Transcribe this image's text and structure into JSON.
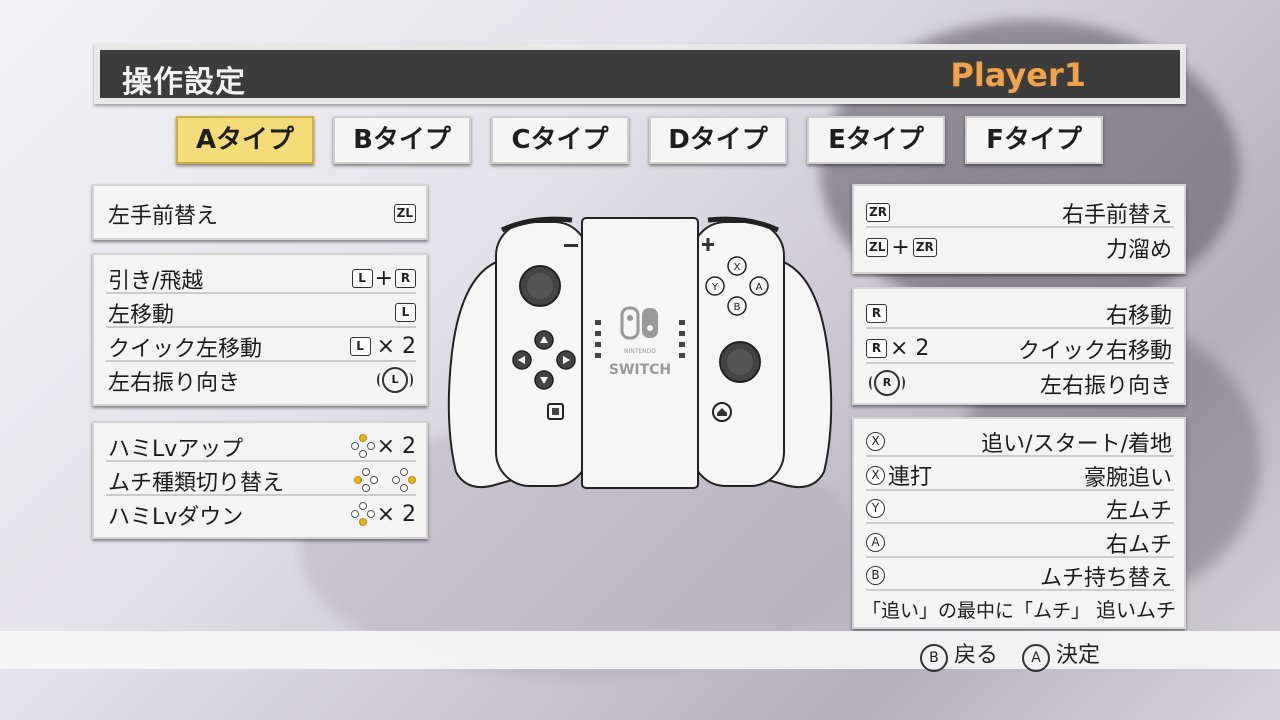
{
  "header": {
    "title": "操作設定",
    "player": "Player1"
  },
  "tabs": [
    "Aタイプ",
    "Bタイプ",
    "Cタイプ",
    "Dタイプ",
    "Eタイプ",
    "Fタイプ"
  ],
  "left": {
    "panel1": {
      "label": "左手前替え",
      "key": "ZL"
    },
    "panel2": [
      {
        "label": "引き/飛越",
        "k1": "L",
        "plus": "+",
        "k2": "R"
      },
      {
        "label": "左移動",
        "k1": "L"
      },
      {
        "label": "クイック左移動",
        "k1": "L",
        "times": "× 2"
      },
      {
        "label": "左右振り向き",
        "stick": "L"
      }
    ],
    "panel3": [
      {
        "label": "ハミLvアップ",
        "times": "× 2"
      },
      {
        "label": "ムチ種類切り替え"
      },
      {
        "label": "ハミLvダウン",
        "times": "× 2"
      }
    ]
  },
  "right": {
    "panel1": [
      {
        "k1": "ZR",
        "label": "右手前替え"
      },
      {
        "k1": "ZL",
        "plus": "+",
        "k2": "ZR",
        "label": "力溜め"
      }
    ],
    "panel2": [
      {
        "k1": "R",
        "label": "右移動"
      },
      {
        "k1": "R",
        "times": "× 2",
        "label": "クイック右移動"
      },
      {
        "stick": "R",
        "label": "左右振り向き"
      }
    ],
    "panel3": [
      {
        "c": "X",
        "label": "追い/スタート/着地"
      },
      {
        "c": "X",
        "extra": "連打",
        "label": "豪腕追い"
      },
      {
        "c": "Y",
        "label": "左ムチ"
      },
      {
        "c": "A",
        "label": "右ムチ"
      },
      {
        "c": "B",
        "label": "ムチ持ち替え"
      },
      {
        "left": "「追い」の最中に「ムチ」",
        "label": "追いムチ"
      }
    ]
  },
  "controller": {
    "brand_top": "NINTENDO",
    "brand_bottom": "SWITCH",
    "buttons": {
      "x": "X",
      "y": "Y",
      "a": "A",
      "b": "B"
    }
  },
  "footer": {
    "back_key": "B",
    "back": "戻る",
    "ok_key": "A",
    "ok": "決定"
  },
  "colors": {
    "accent_tab": "#f4dc78",
    "player": "#f0a34a",
    "header_bg": "#3c3c3c",
    "dpad_on": "#e8b420"
  }
}
